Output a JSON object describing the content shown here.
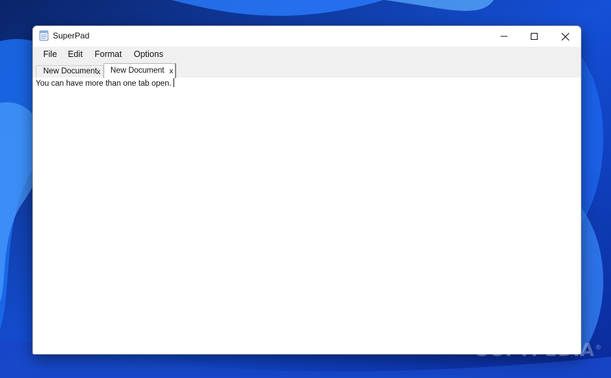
{
  "window": {
    "title": "SuperPad",
    "app_icon": "notepad-icon",
    "controls": [
      "minimize-icon",
      "maximize-icon",
      "close-icon"
    ]
  },
  "menubar": {
    "items": [
      {
        "label": "File"
      },
      {
        "label": "Edit"
      },
      {
        "label": "Format"
      },
      {
        "label": "Options"
      }
    ]
  },
  "tabs": [
    {
      "label": "New Document",
      "close": "x",
      "active": false
    },
    {
      "label": "New Document",
      "close": "x",
      "active": true
    }
  ],
  "editor": {
    "content": "You can have more than one tab open."
  },
  "watermark": {
    "text": "SOFTPEDIA",
    "mark": "®"
  },
  "colors": {
    "wallpaper": "#0a2a8a",
    "chrome": "#f0f0f0",
    "editor_bg": "#ffffff"
  }
}
